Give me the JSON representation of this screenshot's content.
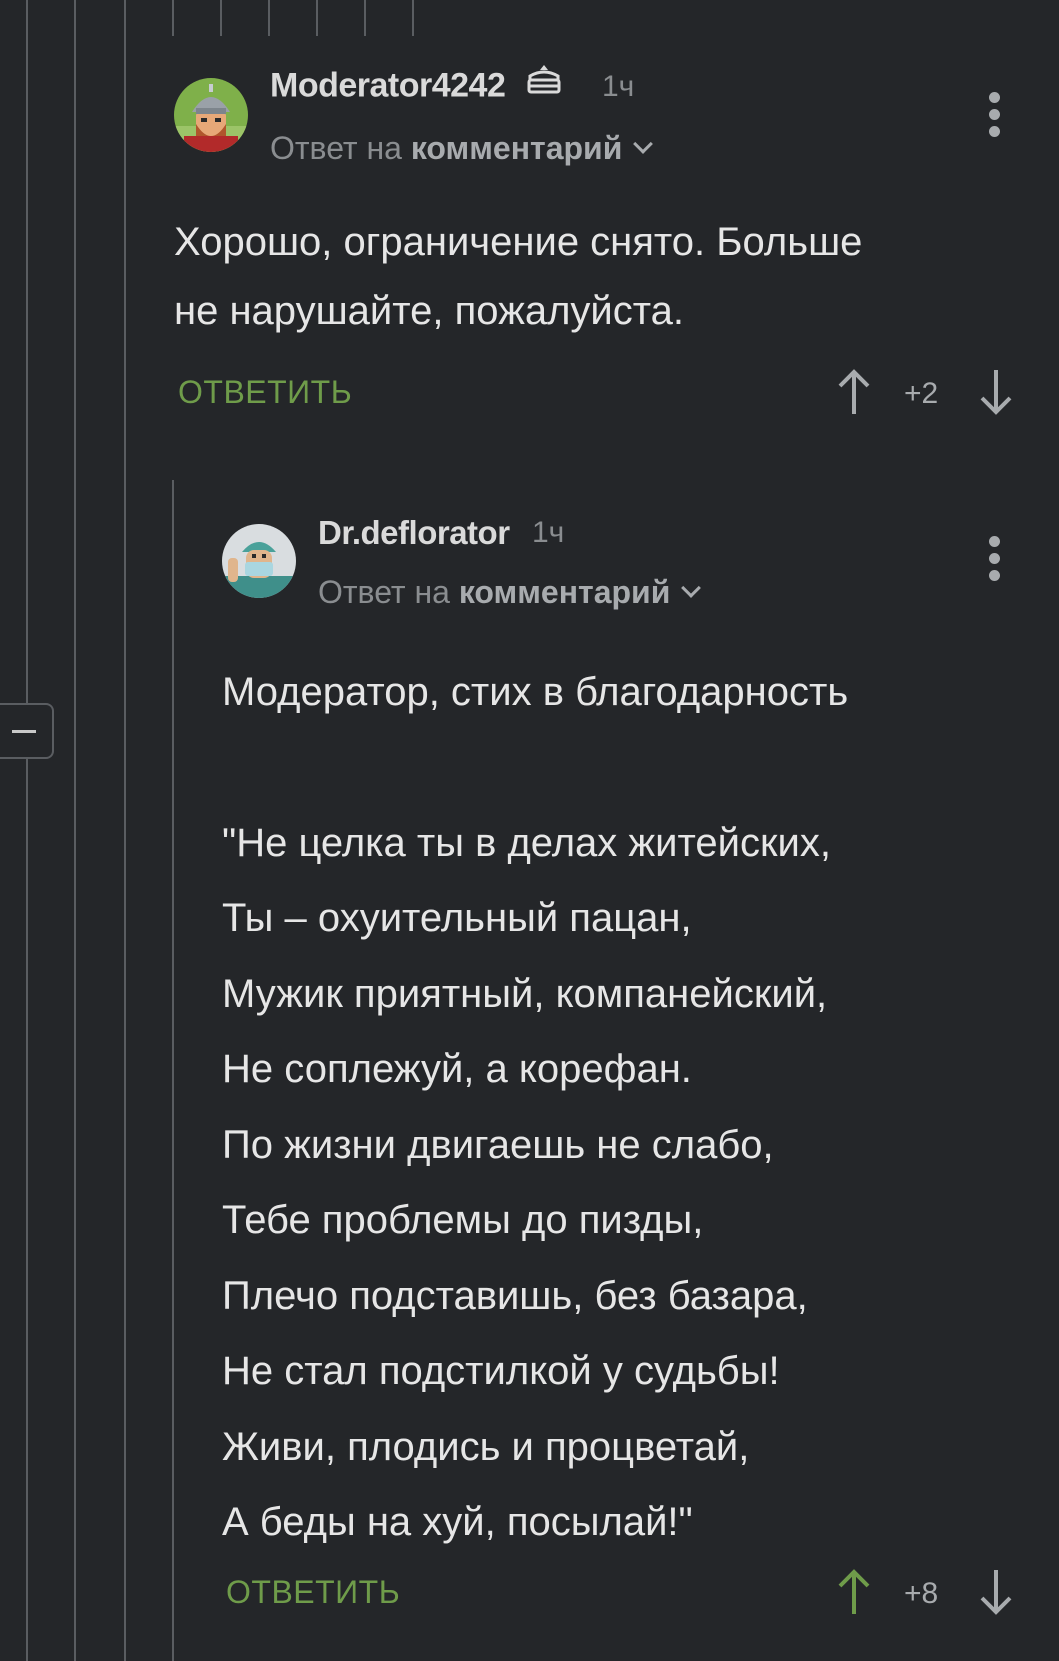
{
  "comments": [
    {
      "username": "Moderator4242",
      "badge_icon": "moderator-cake-icon",
      "time": "1ч",
      "reply_prefix": "Ответ на",
      "reply_target": "комментарий",
      "body": [
        "Хорошо, ограничение снято. Больше",
        "не нарушайте, пожалуйста."
      ],
      "reply_label": "ОТВЕТИТЬ",
      "score": "+2"
    },
    {
      "username": "Dr.deflorator",
      "time": "1ч",
      "reply_prefix": "Ответ на",
      "reply_target": "комментарий",
      "body": [
        "Модератор, стих в благодарность",
        "",
        "\"Не целка ты в делах житейских,",
        "Ты – охуительный пацан,",
        "Мужик приятный, компанейский,",
        "Не соплежуй, а корефан.",
        "По жизни двигаешь не слабо,",
        "Тебе проблемы до пизды,",
        "Плечо подставишь, без базара,",
        "Не стал подстилкой у судьбы!",
        "Живи, плодись и процветай,",
        "А беды на хуй, посылай!\""
      ],
      "reply_label": "ОТВЕТИТЬ",
      "score": "+8"
    }
  ],
  "colors": {
    "background": "#242629",
    "reply_green": "#6f9c4a",
    "upvoted_green": "#6f9c4a",
    "muted": "#8a8d90"
  }
}
